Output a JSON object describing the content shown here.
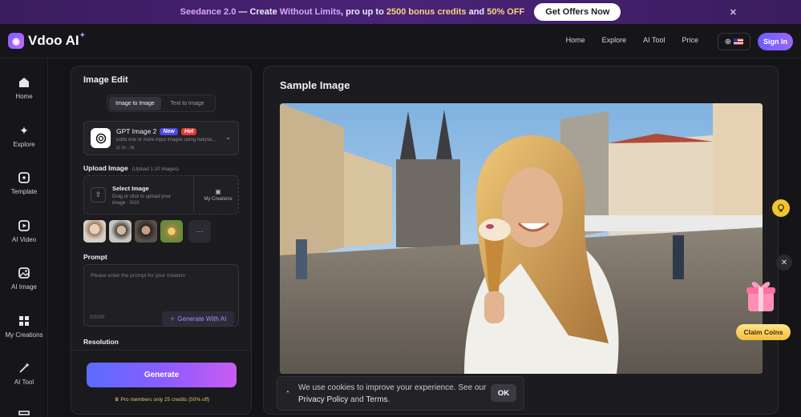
{
  "promo": {
    "part1": "Seedance 2.0",
    "part2": " — Create ",
    "part3": "Without Limits",
    "part4": ", pro up to ",
    "part5": "2500 bonus credits",
    "part6": " and ",
    "part7": "50% OFF",
    "cta": "Get Offers Now",
    "close": "✕"
  },
  "header": {
    "brand": "Vdoo AI",
    "nav": [
      "Home",
      "Explore",
      "AI Tool",
      "Price"
    ],
    "signin": "Sign In"
  },
  "sidebar": {
    "items": [
      {
        "label": "Home",
        "icon": "home-icon"
      },
      {
        "label": "Explore",
        "icon": "sparkle-icon"
      },
      {
        "label": "Template",
        "icon": "template-icon"
      },
      {
        "label": "AI Video",
        "icon": "video-icon"
      },
      {
        "label": "AI Image",
        "icon": "image-icon"
      },
      {
        "label": "My Creations",
        "icon": "grid-icon"
      },
      {
        "label": "AI Tool",
        "icon": "wand-icon"
      }
    ]
  },
  "editor": {
    "title": "Image Edit",
    "tabs": [
      "Image to Image",
      "Text to Image"
    ],
    "model": {
      "name": "GPT Image 2",
      "badge_new": "New",
      "badge_hot": "Hot",
      "desc": "Edits one or more input images using natural...",
      "meta": "1k - 2k"
    },
    "upload": {
      "label": "Upload Image",
      "hint": "(Upload 1-10 Images)",
      "title": "Select Image",
      "sub": "Drag or click to upload your image · 0/10",
      "my_creations": "My Creations"
    },
    "prompt": {
      "label": "Prompt",
      "placeholder": "Please enter the prompt for your creation",
      "count": "0/2000",
      "generate_ai": "Generate With AI"
    },
    "resolution_label": "Resolution",
    "generate": "Generate",
    "pro_note": "Pro members only 25 credits (50% off)"
  },
  "sample": {
    "title": "Sample Image"
  },
  "cookie": {
    "text1": "We use cookies to improve your experience. See our ",
    "privacy": "Privacy Policy",
    "and": " and ",
    "terms": "Terms",
    "dot": ".",
    "ok": "OK"
  },
  "floating": {
    "claim": "Claim Coins"
  }
}
